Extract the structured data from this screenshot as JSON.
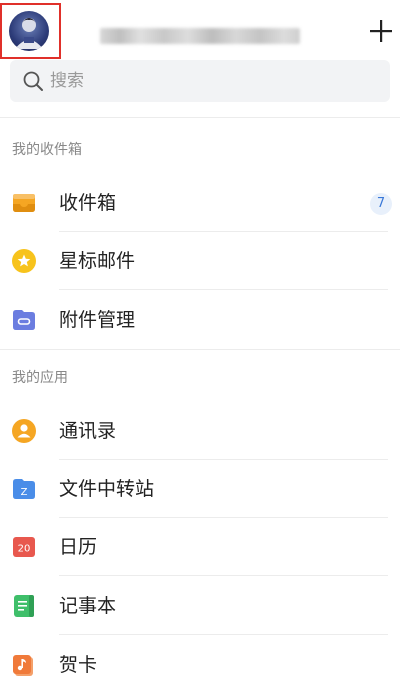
{
  "header": {
    "add_icon": "plus-icon",
    "avatar_icon": "user-avatar"
  },
  "search": {
    "placeholder": "搜索",
    "icon": "search-icon"
  },
  "sections": {
    "mailbox": {
      "title": "我的收件箱",
      "items": [
        {
          "label": "收件箱",
          "icon": "inbox-icon",
          "color": "#f5a623",
          "badge": "7"
        },
        {
          "label": "星标邮件",
          "icon": "star-icon",
          "color": "#f7c31c"
        },
        {
          "label": "附件管理",
          "icon": "attachment-icon",
          "color": "#6b7de0"
        }
      ]
    },
    "apps": {
      "title": "我的应用",
      "items": [
        {
          "label": "通讯录",
          "icon": "contacts-icon",
          "color": "#f5a623"
        },
        {
          "label": "文件中转站",
          "icon": "folder-icon",
          "color": "#4a8de8",
          "glyph": "Z"
        },
        {
          "label": "日历",
          "icon": "calendar-icon",
          "color": "#e8584e",
          "glyph": "20"
        },
        {
          "label": "记事本",
          "icon": "notepad-icon",
          "color": "#3fbf6a"
        },
        {
          "label": "贺卡",
          "icon": "greeting-card-icon",
          "color": "#f07a3a"
        }
      ]
    }
  },
  "colors": {
    "highlight_box": "#e0302a",
    "badge_text": "#3a78d8",
    "badge_bg": "#e8f0fb",
    "section_title": "#888888"
  }
}
